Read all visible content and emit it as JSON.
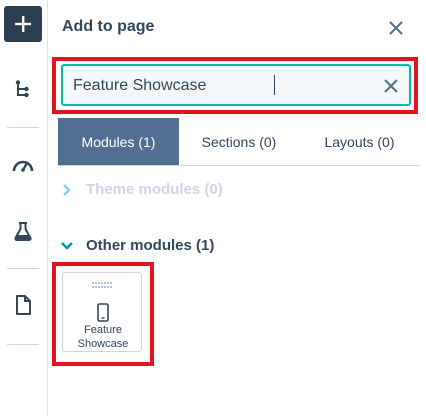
{
  "panel": {
    "title": "Add to page",
    "close_icon": "close-icon"
  },
  "search": {
    "value": "Feature Showcase",
    "clear_icon": "clear-icon"
  },
  "tabs": [
    {
      "label": "Modules (1)",
      "active": true
    },
    {
      "label": "Sections (0)",
      "active": false
    },
    {
      "label": "Layouts (0)",
      "active": false
    }
  ],
  "groups": {
    "theme_modules": {
      "label": "Theme modules (0)",
      "expanded": false
    },
    "other_modules": {
      "label": "Other modules (1)",
      "expanded": true
    }
  },
  "module_card": {
    "label": "Feature Showcase",
    "icon": "mobile-phone-icon"
  },
  "rail": {
    "items": [
      "add-icon",
      "tree-structure-icon",
      "speedometer-icon",
      "flask-icon",
      "document-icon"
    ]
  },
  "colors": {
    "accent_teal": "#00bda5",
    "active_tab": "#516f90",
    "dark": "#2d3e50",
    "highlight_red": "#e3141f",
    "muted": "#cbd6e2"
  }
}
